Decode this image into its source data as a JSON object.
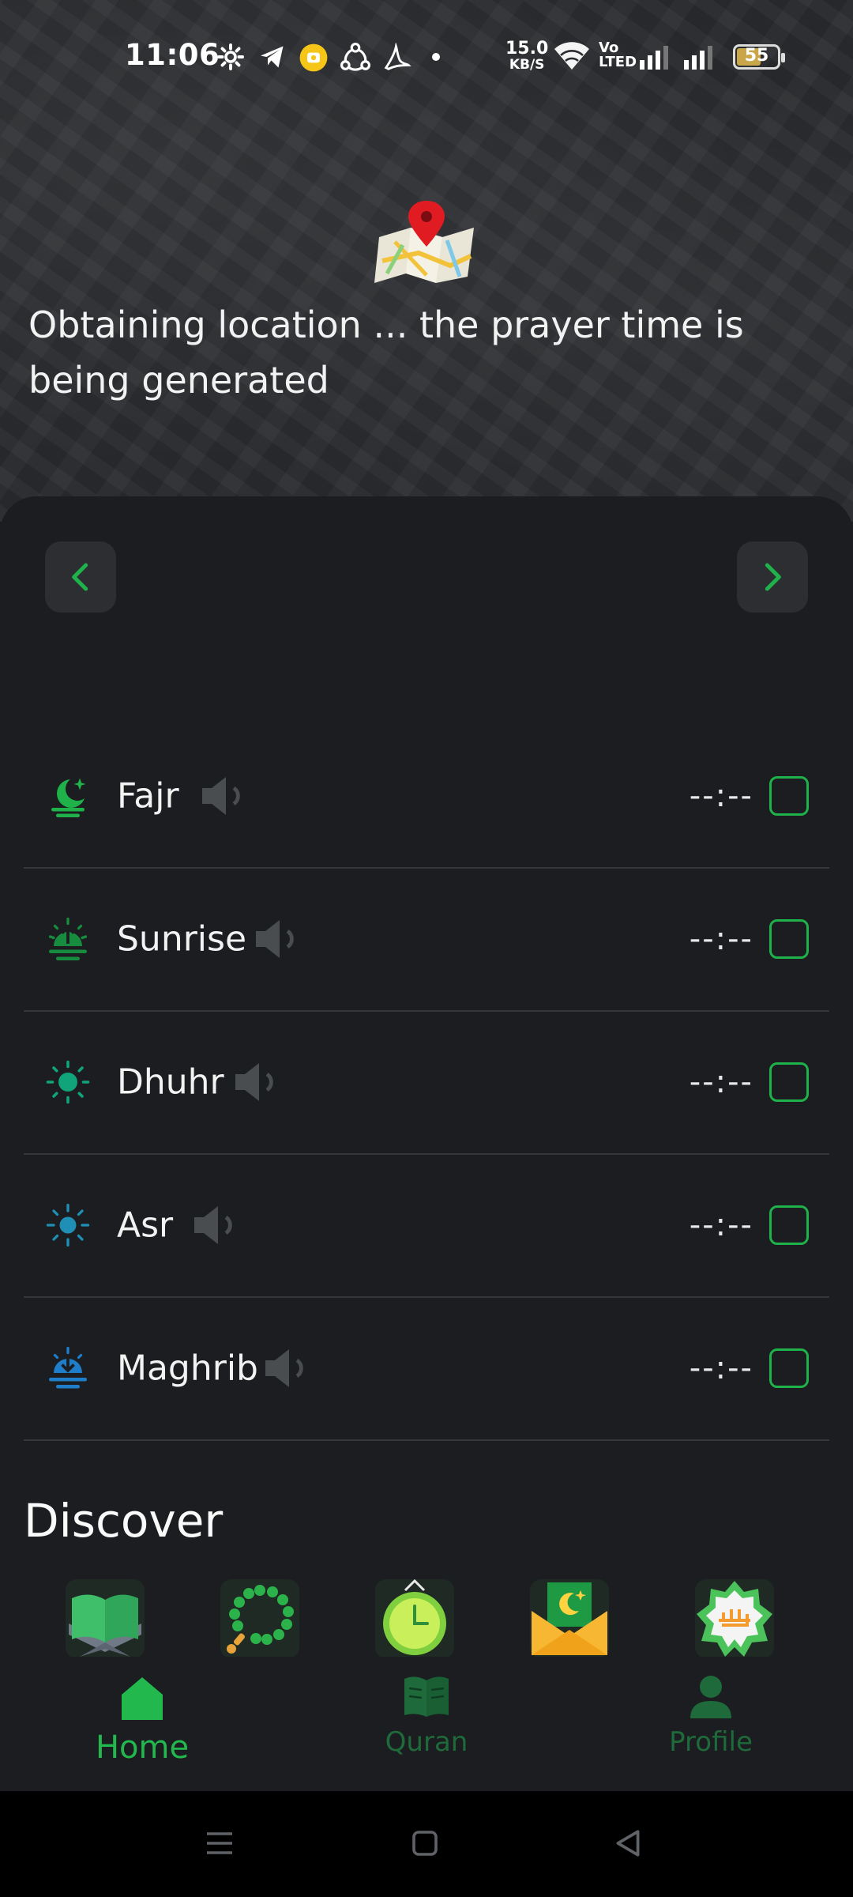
{
  "status_bar": {
    "time": "11:06",
    "net_speed_value": "15.0",
    "net_speed_unit": "KB/S",
    "network_label_top": "Vo",
    "network_label_bottom": "LTED",
    "battery": "55"
  },
  "location": {
    "message": "Obtaining  location ... the prayer time is being generated"
  },
  "prayers": [
    {
      "name": "Fajr",
      "time": "--:--",
      "icon": "fajr-icon"
    },
    {
      "name": "Sunrise",
      "time": "--:--",
      "icon": "sunrise-icon"
    },
    {
      "name": "Dhuhr",
      "time": "--:--",
      "icon": "dhuhr-icon"
    },
    {
      "name": "Asr",
      "time": "--:--",
      "icon": "asr-icon"
    },
    {
      "name": "Maghrib",
      "time": "--:--",
      "icon": "maghrib-icon"
    }
  ],
  "discover": {
    "title": "Discover",
    "items": [
      "quran-book-icon",
      "tasbih-beads-icon",
      "clock-icon",
      "envelope-moon-icon",
      "allah-calligraphy-icon"
    ]
  },
  "bottom_nav": {
    "home": "Home",
    "quran": "Quran",
    "profile": "Profile"
  },
  "colors": {
    "accent": "#1fb24a",
    "background": "#1b1d20",
    "muted_tab": "#1f6a3a"
  }
}
